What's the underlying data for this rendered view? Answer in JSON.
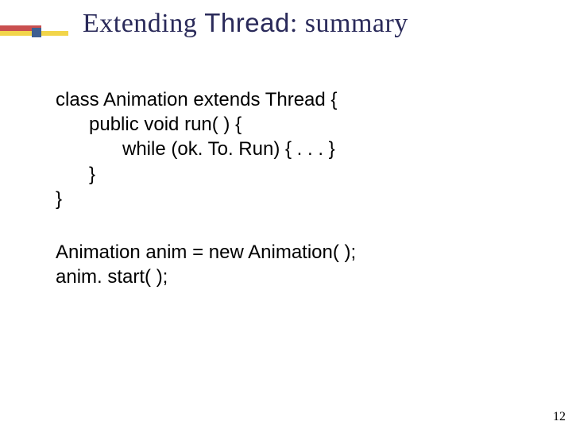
{
  "title": {
    "part1": "Extending ",
    "part2_sans": "Thread",
    "part3": ": summary"
  },
  "code": {
    "block1": {
      "l1": "class Animation extends Thread {",
      "l2": "public void run( ) {",
      "l3": "while (ok. To. Run) { . . . }",
      "l4": "}",
      "l5": "}"
    },
    "block2": {
      "l1": "Animation anim = new Animation( );",
      "l2": "anim. start( );"
    }
  },
  "pagenum": "12"
}
